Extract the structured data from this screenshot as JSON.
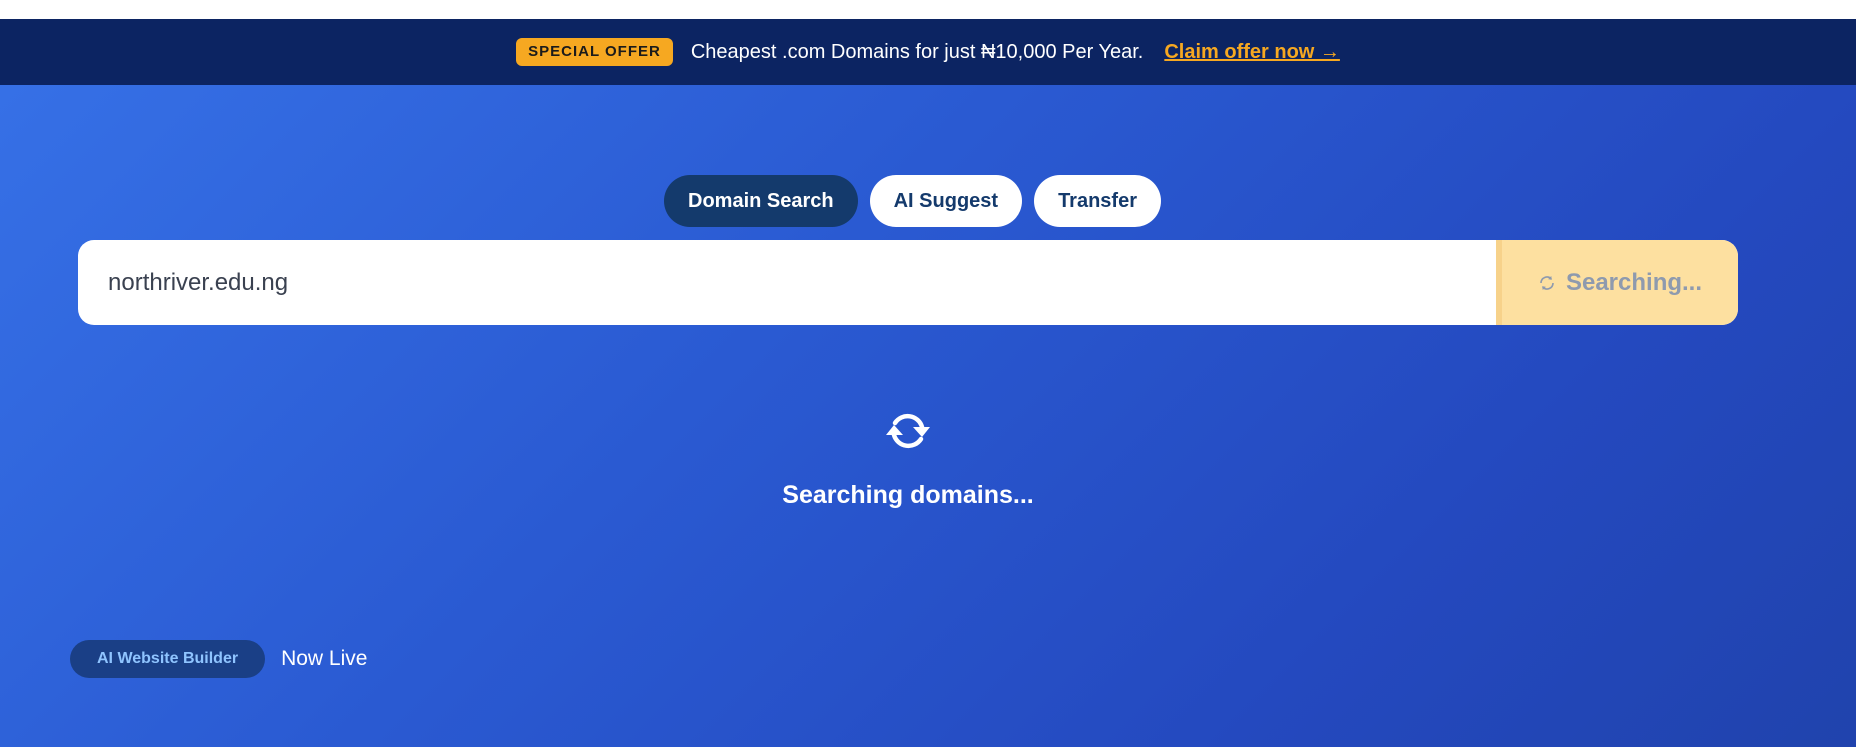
{
  "promo": {
    "badge": "SPECIAL OFFER",
    "text": "Cheapest .com Domains for just ₦10,000 Per Year.",
    "link": "Claim offer now →"
  },
  "tabs": [
    {
      "label": "Domain Search",
      "active": true
    },
    {
      "label": "AI Suggest",
      "active": false
    },
    {
      "label": "Transfer",
      "active": false
    }
  ],
  "search": {
    "value": "northriver.edu.ng",
    "button_label": "Searching..."
  },
  "status": {
    "icon": "sync-icon",
    "text": "Searching domains..."
  },
  "builder": {
    "badge": "AI Website Builder",
    "text": "Now Live"
  },
  "colors": {
    "promo_bg": "#0c2462",
    "accent": "#f6a821",
    "hero_bg": "#2a5ad2",
    "tab_active": "#143a6c",
    "button_bg": "#fde0a0"
  }
}
